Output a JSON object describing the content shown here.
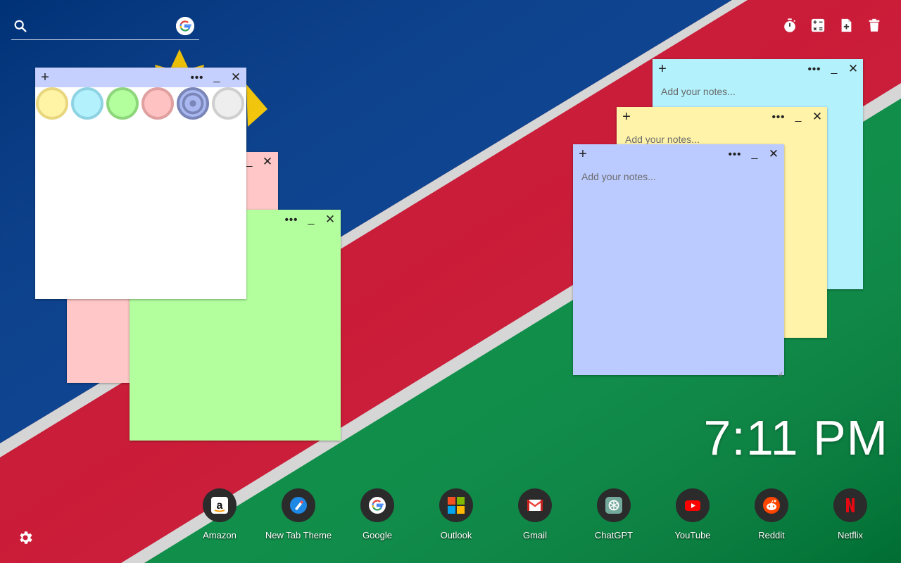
{
  "search": {
    "value": "",
    "placeholder": ""
  },
  "toolbar": {
    "icons": [
      "timer-icon",
      "calculator-icon",
      "new-note-icon",
      "trash-icon"
    ]
  },
  "notes": [
    {
      "id": "pink",
      "color": "#ffc7c7",
      "placeholder": ""
    },
    {
      "id": "green",
      "color": "#b3ff9e",
      "placeholder": ""
    },
    {
      "id": "white",
      "color": "#ffffff",
      "header_color": "#c5d0ff",
      "placeholder": ""
    },
    {
      "id": "cyan",
      "color": "#b3f1fc",
      "placeholder": "Add your notes..."
    },
    {
      "id": "yellow",
      "color": "#fff3a9",
      "placeholder": "Add your notes..."
    },
    {
      "id": "periwinkle",
      "color": "#bccbff",
      "placeholder": "Add your notes..."
    }
  ],
  "palette": [
    {
      "name": "yellow",
      "fill": "#fff3a6",
      "ring": "#e8d77f"
    },
    {
      "name": "cyan",
      "fill": "#b3f1fc",
      "ring": "#8fd3e3"
    },
    {
      "name": "green",
      "fill": "#b3ff9e",
      "ring": "#8ed67c"
    },
    {
      "name": "pink",
      "fill": "#ffc2c2",
      "ring": "#e0a0a0"
    },
    {
      "name": "blue",
      "fill": "#a9b8f0",
      "ring": "#7a85b8",
      "selected": true
    },
    {
      "name": "gray",
      "fill": "#eeeeee",
      "ring": "#cfcfcf"
    }
  ],
  "clock": {
    "time": "7:11 PM"
  },
  "shortcuts": [
    {
      "label": "Amazon",
      "icon": "amazon-icon"
    },
    {
      "label": "New Tab Theme",
      "icon": "new-tab-theme-icon"
    },
    {
      "label": "Google",
      "icon": "google-icon"
    },
    {
      "label": "Outlook",
      "icon": "outlook-icon"
    },
    {
      "label": "Gmail",
      "icon": "gmail-icon"
    },
    {
      "label": "ChatGPT",
      "icon": "chatgpt-icon"
    },
    {
      "label": "YouTube",
      "icon": "youtube-icon"
    },
    {
      "label": "Reddit",
      "icon": "reddit-icon"
    },
    {
      "label": "Netflix",
      "icon": "netflix-icon"
    }
  ],
  "colors": {
    "flag_blue": "#003a8c",
    "flag_red": "#c8102e",
    "flag_green": "#00893f",
    "flag_white": "#d6d6d6",
    "flag_sun": "#ffce00"
  }
}
